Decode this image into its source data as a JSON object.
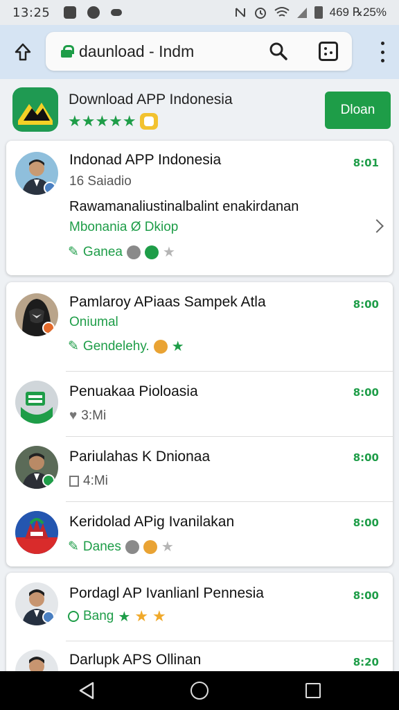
{
  "status": {
    "time": "13:25",
    "right_text": "469 ℞25%"
  },
  "browser": {
    "url": "daunload - Indm"
  },
  "app": {
    "title": "Download APP Indonesia",
    "stars": "★★★★★",
    "download_label": "Dloan",
    "accent": "#1e9d48"
  },
  "featured": {
    "title": "Indonad APP Indonesia",
    "subtitle": "16 Saiadio",
    "line1": "Rawamanaliustinalbalint enakirdanan",
    "line2": "Mbonania Ø Dkiop",
    "tag": "Ganea",
    "time": "8:01"
  },
  "group1": [
    {
      "title": "Pamlaroy APiaas Sampek Atla",
      "subtitle": "Oniumal",
      "tag": "Gendelehy.",
      "time": "8:00"
    },
    {
      "title": "Penuakaa Pioloasia",
      "subtitle": "3:Mi",
      "time": "8:00"
    },
    {
      "title": "Pariulahas K Dnionaa",
      "subtitle": "4:Mi",
      "time": "8:00"
    },
    {
      "title": "Keridolad APig Ivanilakan",
      "tag": "Danes",
      "time": "8:00"
    }
  ],
  "group2": [
    {
      "title": "Pordagl AP Ivanlianl Pennesia",
      "tag": "Bang",
      "time": "8:00"
    },
    {
      "title": "Darlupk APS Ollinan",
      "time": "8:20"
    }
  ]
}
